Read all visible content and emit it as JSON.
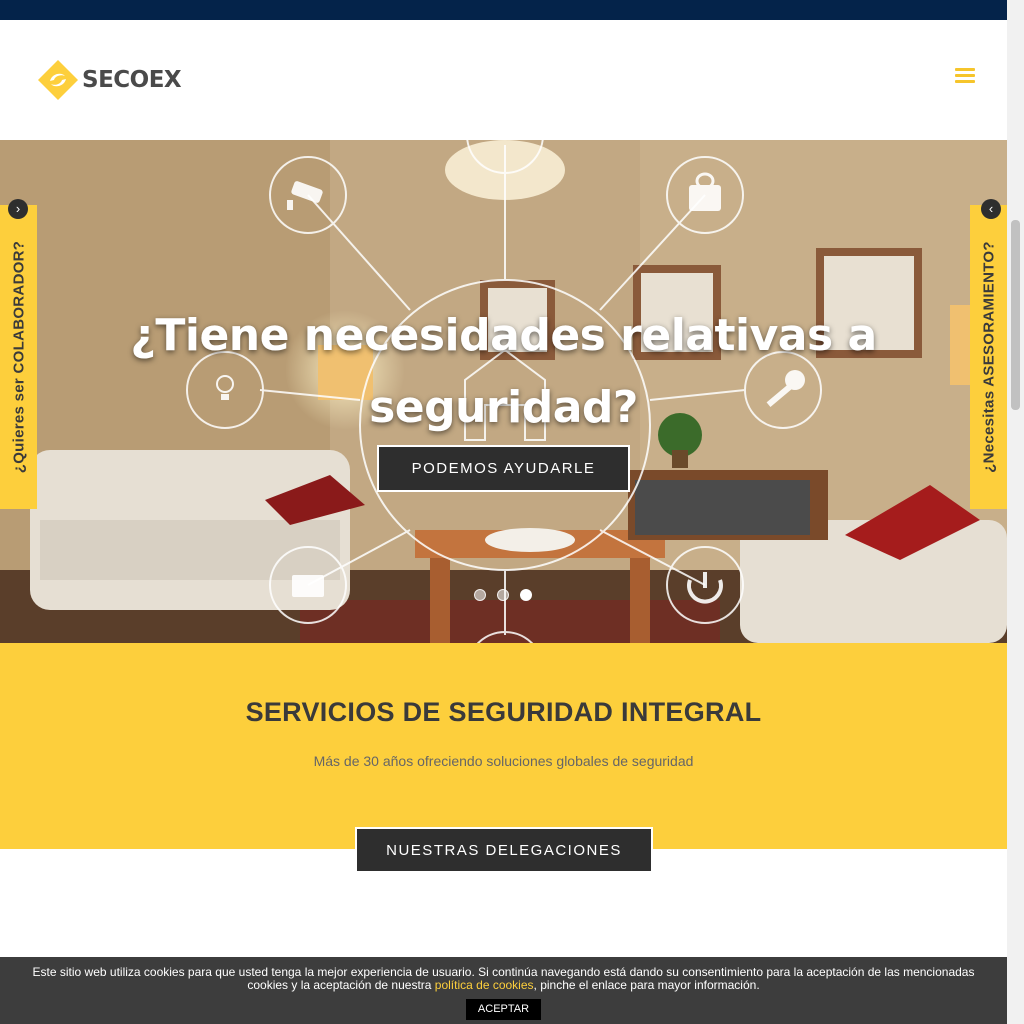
{
  "header": {
    "logo_text": "SECOEX",
    "menu_icon": "hamburger-icon"
  },
  "colors": {
    "accent": "#fdcf3c",
    "topbar": "#04234a",
    "button_bg": "#2e2e2e",
    "cookie_bg": "#3d3d3d"
  },
  "hero": {
    "title": "¿Tiene necesidades relativas a seguridad?",
    "button_label": "PODEMOS AYUDARLE",
    "slides_total": 3,
    "active_slide": 3,
    "icons": [
      "camera-icon",
      "lock-icon",
      "lightbulb-icon",
      "key-icon",
      "video-icon",
      "power-icon",
      "house-icon"
    ]
  },
  "side_tabs": {
    "left": {
      "label": "¿Quieres ser COLABORADOR?",
      "arrow": "›"
    },
    "right": {
      "label": "¿Necesitas ASESORAMIENTO?",
      "arrow": "‹"
    }
  },
  "services": {
    "title": "SERVICIOS DE SEGURIDAD INTEGRAL",
    "subtitle": "Más de 30 años ofreciendo soluciones globales de seguridad",
    "button_label": "NUESTRAS DELEGACIONES"
  },
  "cookie": {
    "text_before": "Este sitio web utiliza cookies para que usted tenga la mejor experiencia de usuario. Si continúa navegando está dando su consentimiento para la aceptación de las mencionadas cookies y la aceptación de nuestra ",
    "link_text": "política de cookies",
    "text_after": ", pinche el enlace para mayor información.",
    "accept_label": "ACEPTAR"
  }
}
